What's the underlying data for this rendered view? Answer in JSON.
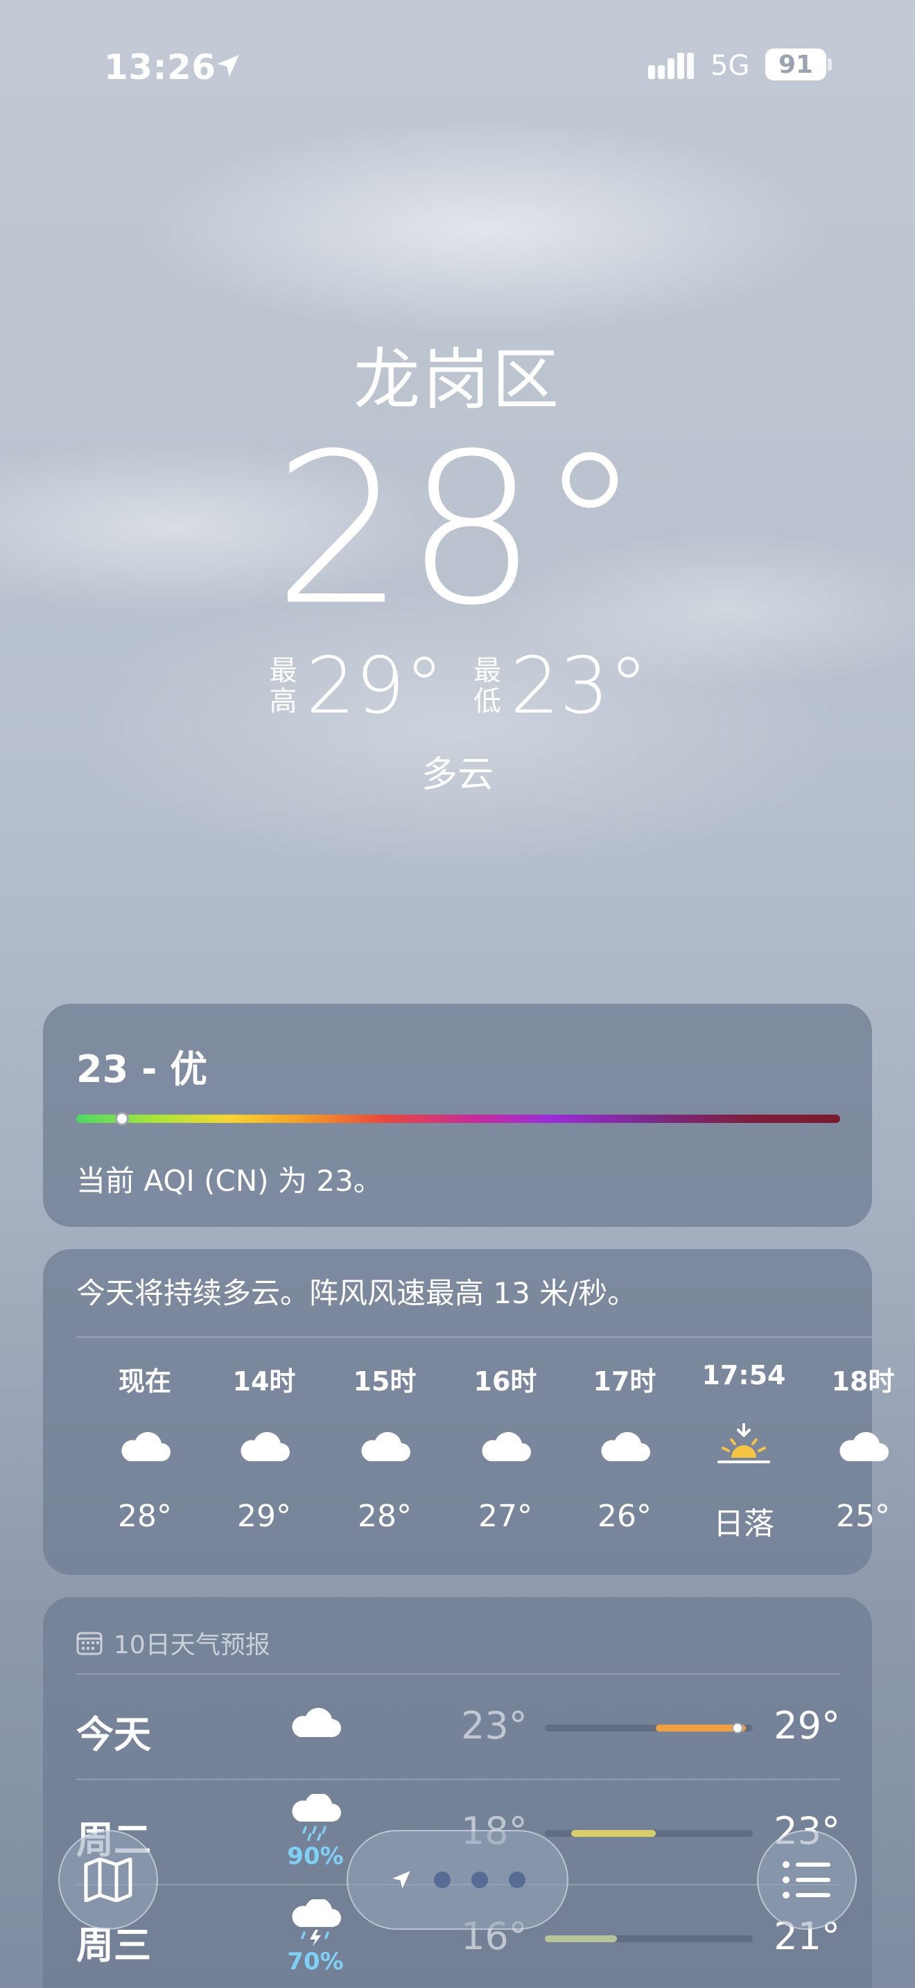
{
  "status_bar": {
    "time": "13:26",
    "network": "5G",
    "battery": "91"
  },
  "hero": {
    "city": "龙岗区",
    "temperature": "28°",
    "high_label": "最高",
    "high": "29°",
    "low_label": "最低",
    "low": "23°",
    "condition": "多云"
  },
  "aqi_card": {
    "title": "23 - 优",
    "value": 23,
    "description": "当前 AQI (CN) 为 23。"
  },
  "hourly_card": {
    "summary": "今天将持续多云。阵风风速最高 13 米/秒。",
    "hours": [
      {
        "label": "现在",
        "icon": "cloud-icon",
        "temp": "28°"
      },
      {
        "label": "14时",
        "icon": "cloud-icon",
        "temp": "29°"
      },
      {
        "label": "15时",
        "icon": "cloud-icon",
        "temp": "28°"
      },
      {
        "label": "16时",
        "icon": "cloud-icon",
        "temp": "27°"
      },
      {
        "label": "17时",
        "icon": "cloud-icon",
        "temp": "26°"
      },
      {
        "label": "17:54",
        "icon": "sunset-icon",
        "temp": "日落"
      },
      {
        "label": "18时",
        "icon": "cloud-icon",
        "temp": "25°"
      }
    ]
  },
  "daily_card": {
    "header": "10日天气预报",
    "days": [
      {
        "day": "今天",
        "icon": "cloud-icon",
        "precip": "",
        "low": "23°",
        "high": "29°"
      },
      {
        "day": "周二",
        "icon": "rain-cloud-icon",
        "precip": "90%",
        "low": "18°",
        "high": "23°"
      },
      {
        "day": "周三",
        "icon": "thunderstorm-icon",
        "precip": "70%",
        "low": "16°",
        "high": "21°"
      }
    ]
  },
  "colors": {
    "sunset_icon": "#f5c542",
    "precip_text": "#7fd0f5",
    "today_bar": "#f0a040",
    "tue_bar": "#d9cf6a",
    "wed_bar": "#b9c39a"
  }
}
